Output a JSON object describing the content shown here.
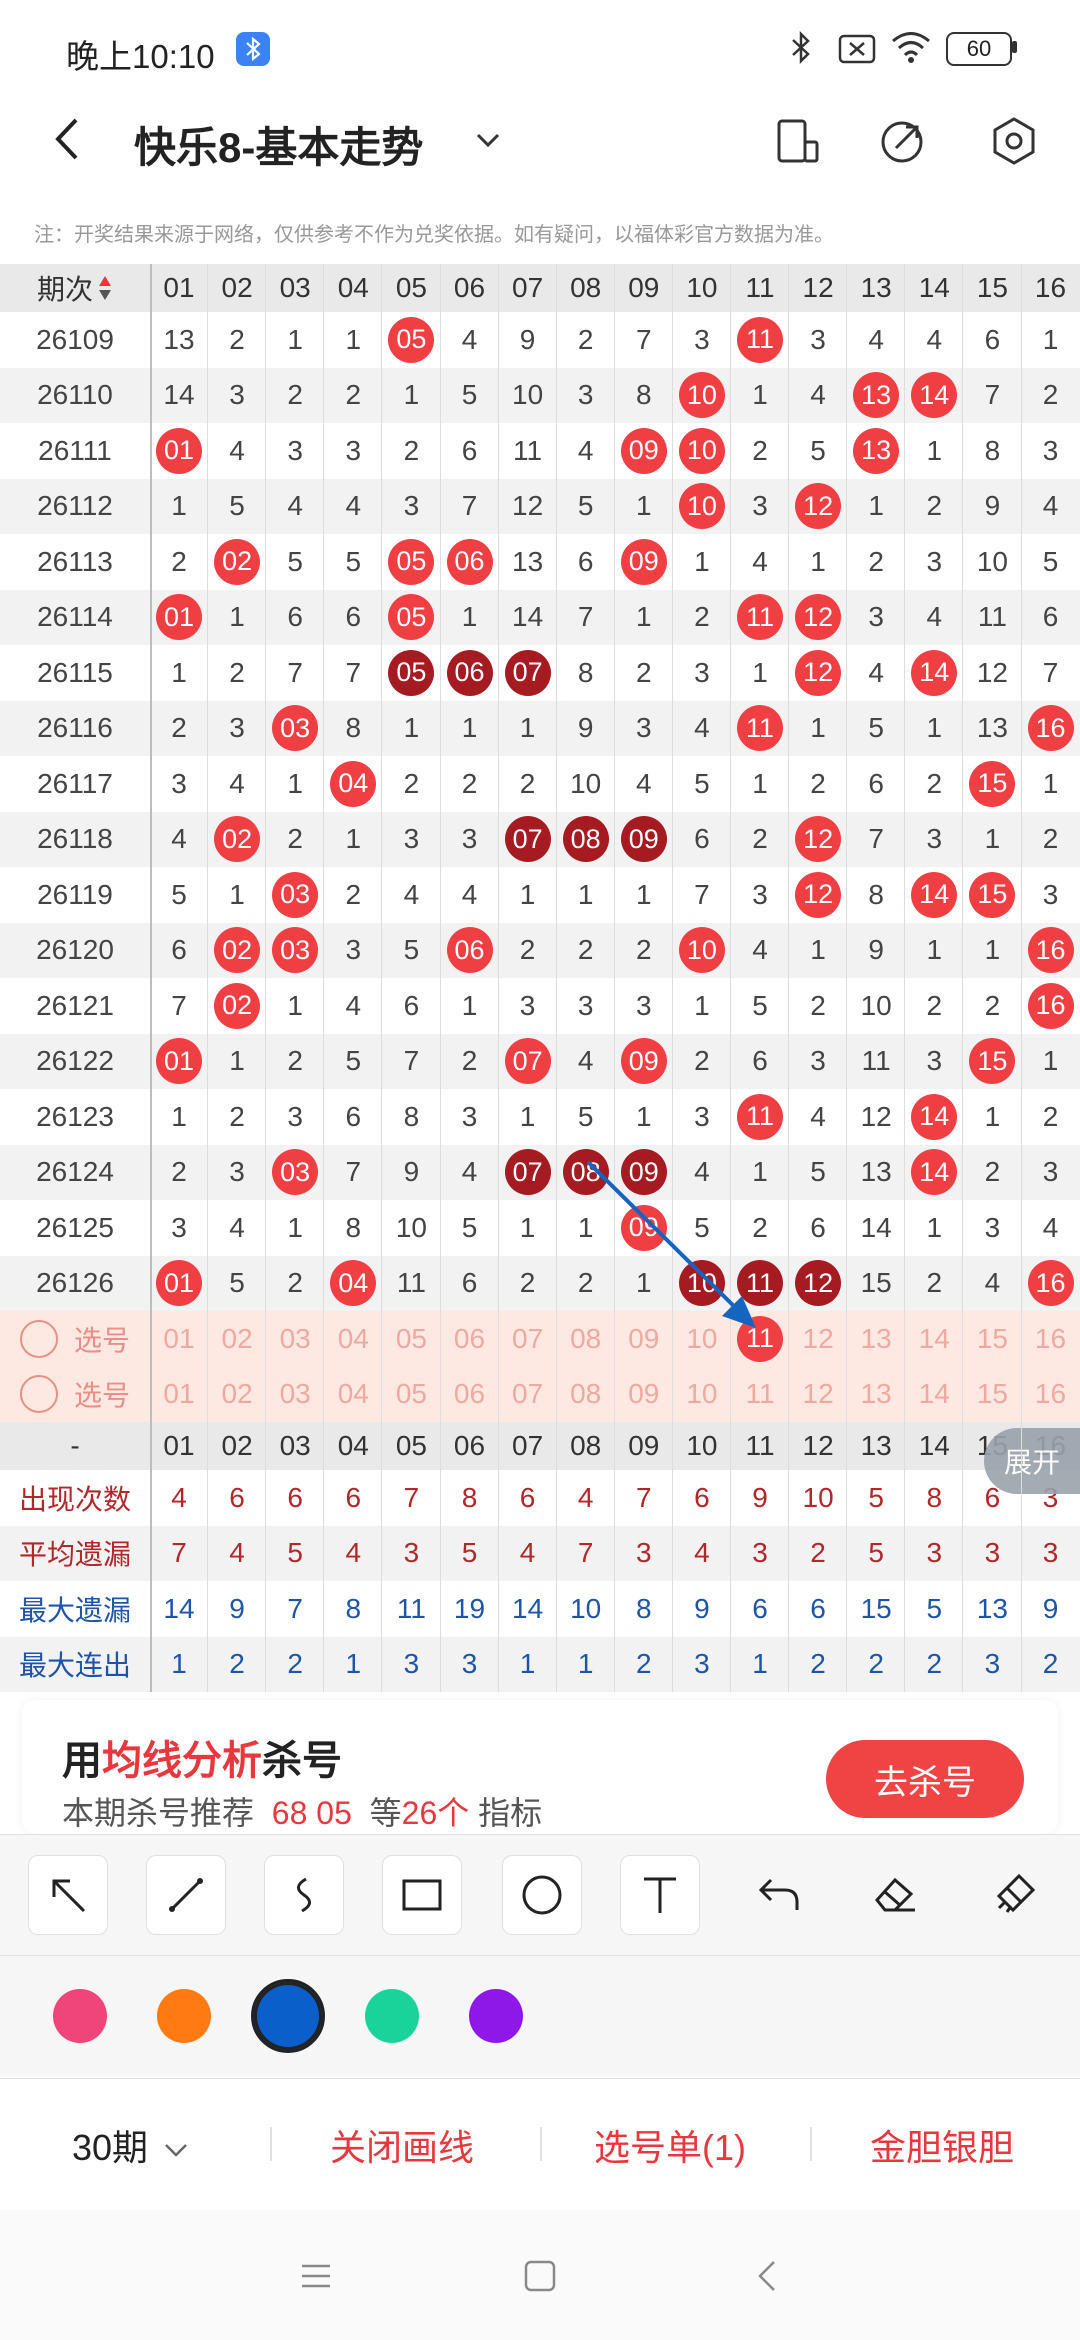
{
  "status_bar": {
    "time": "晚上10:10",
    "battery": "60"
  },
  "header": {
    "title": "快乐8-基本走势"
  },
  "notice": "注：开奖结果来源于网络，仅供参考不作为兑奖依据。如有疑问，以福体彩官方数据为准。",
  "table": {
    "issue_header": "期次",
    "columns": [
      "01",
      "02",
      "03",
      "04",
      "05",
      "06",
      "07",
      "08",
      "09",
      "10",
      "11",
      "12",
      "13",
      "14",
      "15",
      "16"
    ],
    "rows": [
      {
        "issue": "26109",
        "cells": [
          "13",
          "2",
          "1",
          "1",
          "05",
          "4",
          "9",
          "2",
          "7",
          "3",
          "11",
          "3",
          "4",
          "4",
          "6",
          "1"
        ],
        "balls": [
          0,
          0,
          0,
          0,
          1,
          0,
          0,
          0,
          0,
          0,
          1,
          0,
          0,
          0,
          0,
          0
        ]
      },
      {
        "issue": "26110",
        "cells": [
          "14",
          "3",
          "2",
          "2",
          "1",
          "5",
          "10",
          "3",
          "8",
          "10",
          "1",
          "4",
          "13",
          "14",
          "7",
          "2"
        ],
        "balls": [
          0,
          0,
          0,
          0,
          0,
          0,
          0,
          0,
          0,
          1,
          0,
          0,
          1,
          1,
          0,
          0
        ]
      },
      {
        "issue": "26111",
        "cells": [
          "01",
          "4",
          "3",
          "3",
          "2",
          "6",
          "11",
          "4",
          "09",
          "10",
          "2",
          "5",
          "13",
          "1",
          "8",
          "3"
        ],
        "balls": [
          1,
          0,
          0,
          0,
          0,
          0,
          0,
          0,
          1,
          1,
          0,
          0,
          1,
          0,
          0,
          0
        ]
      },
      {
        "issue": "26112",
        "cells": [
          "1",
          "5",
          "4",
          "4",
          "3",
          "7",
          "12",
          "5",
          "1",
          "10",
          "3",
          "12",
          "1",
          "2",
          "9",
          "4"
        ],
        "balls": [
          0,
          0,
          0,
          0,
          0,
          0,
          0,
          0,
          0,
          1,
          0,
          1,
          0,
          0,
          0,
          0
        ]
      },
      {
        "issue": "26113",
        "cells": [
          "2",
          "02",
          "5",
          "5",
          "05",
          "06",
          "13",
          "6",
          "09",
          "1",
          "4",
          "1",
          "2",
          "3",
          "10",
          "5"
        ],
        "balls": [
          0,
          1,
          0,
          0,
          1,
          1,
          0,
          0,
          1,
          0,
          0,
          0,
          0,
          0,
          0,
          0
        ]
      },
      {
        "issue": "26114",
        "cells": [
          "01",
          "1",
          "6",
          "6",
          "05",
          "1",
          "14",
          "7",
          "1",
          "2",
          "11",
          "12",
          "3",
          "4",
          "11",
          "6"
        ],
        "balls": [
          1,
          0,
          0,
          0,
          1,
          0,
          0,
          0,
          0,
          0,
          1,
          1,
          0,
          0,
          0,
          0
        ]
      },
      {
        "issue": "26115",
        "cells": [
          "1",
          "2",
          "7",
          "7",
          "05",
          "06",
          "07",
          "8",
          "2",
          "3",
          "1",
          "12",
          "4",
          "14",
          "12",
          "7"
        ],
        "balls": [
          0,
          0,
          0,
          0,
          2,
          2,
          2,
          0,
          0,
          0,
          0,
          1,
          0,
          1,
          0,
          0
        ]
      },
      {
        "issue": "26116",
        "cells": [
          "2",
          "3",
          "03",
          "8",
          "1",
          "1",
          "1",
          "9",
          "3",
          "4",
          "11",
          "1",
          "5",
          "1",
          "13",
          "16"
        ],
        "balls": [
          0,
          0,
          1,
          0,
          0,
          0,
          0,
          0,
          0,
          0,
          1,
          0,
          0,
          0,
          0,
          1
        ]
      },
      {
        "issue": "26117",
        "cells": [
          "3",
          "4",
          "1",
          "04",
          "2",
          "2",
          "2",
          "10",
          "4",
          "5",
          "1",
          "2",
          "6",
          "2",
          "15",
          "1"
        ],
        "balls": [
          0,
          0,
          0,
          1,
          0,
          0,
          0,
          0,
          0,
          0,
          0,
          0,
          0,
          0,
          1,
          0
        ]
      },
      {
        "issue": "26118",
        "cells": [
          "4",
          "02",
          "2",
          "1",
          "3",
          "3",
          "07",
          "08",
          "09",
          "6",
          "2",
          "12",
          "7",
          "3",
          "1",
          "2"
        ],
        "balls": [
          0,
          1,
          0,
          0,
          0,
          0,
          2,
          2,
          2,
          0,
          0,
          1,
          0,
          0,
          0,
          0
        ]
      },
      {
        "issue": "26119",
        "cells": [
          "5",
          "1",
          "03",
          "2",
          "4",
          "4",
          "1",
          "1",
          "1",
          "7",
          "3",
          "12",
          "8",
          "14",
          "15",
          "3"
        ],
        "balls": [
          0,
          0,
          1,
          0,
          0,
          0,
          0,
          0,
          0,
          0,
          0,
          1,
          0,
          1,
          1,
          0
        ]
      },
      {
        "issue": "26120",
        "cells": [
          "6",
          "02",
          "03",
          "3",
          "5",
          "06",
          "2",
          "2",
          "2",
          "10",
          "4",
          "1",
          "9",
          "1",
          "1",
          "16"
        ],
        "balls": [
          0,
          1,
          1,
          0,
          0,
          1,
          0,
          0,
          0,
          1,
          0,
          0,
          0,
          0,
          0,
          1
        ]
      },
      {
        "issue": "26121",
        "cells": [
          "7",
          "02",
          "1",
          "4",
          "6",
          "1",
          "3",
          "3",
          "3",
          "1",
          "5",
          "2",
          "10",
          "2",
          "2",
          "16"
        ],
        "balls": [
          0,
          1,
          0,
          0,
          0,
          0,
          0,
          0,
          0,
          0,
          0,
          0,
          0,
          0,
          0,
          1
        ]
      },
      {
        "issue": "26122",
        "cells": [
          "01",
          "1",
          "2",
          "5",
          "7",
          "2",
          "07",
          "4",
          "09",
          "2",
          "6",
          "3",
          "11",
          "3",
          "15",
          "1"
        ],
        "balls": [
          1,
          0,
          0,
          0,
          0,
          0,
          1,
          0,
          1,
          0,
          0,
          0,
          0,
          0,
          1,
          0
        ]
      },
      {
        "issue": "26123",
        "cells": [
          "1",
          "2",
          "3",
          "6",
          "8",
          "3",
          "1",
          "5",
          "1",
          "3",
          "11",
          "4",
          "12",
          "14",
          "1",
          "2"
        ],
        "balls": [
          0,
          0,
          0,
          0,
          0,
          0,
          0,
          0,
          0,
          0,
          1,
          0,
          0,
          1,
          0,
          0
        ]
      },
      {
        "issue": "26124",
        "cells": [
          "2",
          "3",
          "03",
          "7",
          "9",
          "4",
          "07",
          "08",
          "09",
          "4",
          "1",
          "5",
          "13",
          "14",
          "2",
          "3"
        ],
        "balls": [
          0,
          0,
          1,
          0,
          0,
          0,
          2,
          2,
          2,
          0,
          0,
          0,
          0,
          1,
          0,
          0
        ]
      },
      {
        "issue": "26125",
        "cells": [
          "3",
          "4",
          "1",
          "8",
          "10",
          "5",
          "1",
          "1",
          "09",
          "5",
          "2",
          "6",
          "14",
          "1",
          "3",
          "4"
        ],
        "balls": [
          0,
          0,
          0,
          0,
          0,
          0,
          0,
          0,
          1,
          0,
          0,
          0,
          0,
          0,
          0,
          0
        ]
      },
      {
        "issue": "26126",
        "cells": [
          "01",
          "5",
          "2",
          "04",
          "11",
          "6",
          "2",
          "2",
          "1",
          "10",
          "11",
          "12",
          "15",
          "2",
          "4",
          "16"
        ],
        "balls": [
          1,
          0,
          0,
          1,
          0,
          0,
          0,
          0,
          0,
          2,
          2,
          2,
          0,
          0,
          0,
          1
        ]
      }
    ],
    "pick_label": "选号",
    "pick_selected": [
      0,
      0,
      0,
      0,
      0,
      0,
      0,
      0,
      0,
      0,
      1,
      0,
      0,
      0,
      0,
      0
    ],
    "separator_label": "-",
    "stats": [
      {
        "label": "出现次数",
        "color": "red",
        "values": [
          "4",
          "6",
          "6",
          "6",
          "7",
          "8",
          "6",
          "4",
          "7",
          "6",
          "9",
          "10",
          "5",
          "8",
          "6",
          "3"
        ]
      },
      {
        "label": "平均遗漏",
        "color": "red",
        "values": [
          "7",
          "4",
          "5",
          "4",
          "3",
          "5",
          "4",
          "7",
          "3",
          "4",
          "3",
          "2",
          "5",
          "3",
          "3",
          "3"
        ]
      },
      {
        "label": "最大遗漏",
        "color": "blue",
        "values": [
          "14",
          "9",
          "7",
          "8",
          "11",
          "19",
          "14",
          "10",
          "8",
          "9",
          "6",
          "6",
          "15",
          "5",
          "13",
          "9"
        ]
      },
      {
        "label": "最大连出",
        "color": "blue",
        "values": [
          "1",
          "2",
          "2",
          "1",
          "3",
          "3",
          "1",
          "1",
          "2",
          "3",
          "1",
          "2",
          "2",
          "2",
          "3",
          "2"
        ]
      }
    ]
  },
  "expand_label": "展开",
  "promo": {
    "title_prefix": "用",
    "title_highlight": "均线分析",
    "title_suffix": "杀号",
    "sub_prefix": "本期杀号推荐",
    "sub_numbers": "68 05",
    "sub_mid": "等",
    "sub_count": "26个",
    "sub_suffix": "指标",
    "button": "去杀号"
  },
  "drawing_tools": [
    "arrow-icon",
    "line-icon",
    "curve-icon",
    "rectangle-icon",
    "circle-icon",
    "text-icon",
    "undo-icon",
    "eraser-icon",
    "clear-icon"
  ],
  "palette": [
    {
      "name": "pink",
      "color": "#f0457a"
    },
    {
      "name": "orange",
      "color": "#ff7a12"
    },
    {
      "name": "blue",
      "color": "#0b5fcb",
      "selected": true
    },
    {
      "name": "green",
      "color": "#19d39a"
    },
    {
      "name": "purple",
      "color": "#8d18e8"
    }
  ],
  "bottom_bar": {
    "period": "30期",
    "close_drawing": "关闭画线",
    "pick_list": "选号单(1)",
    "golden": "金胆银胆"
  },
  "colors": {
    "accent": "#e8383d",
    "ball_red": "#ef3f43",
    "ball_dark": "#a51b21",
    "pen_blue": "#1565c0"
  }
}
